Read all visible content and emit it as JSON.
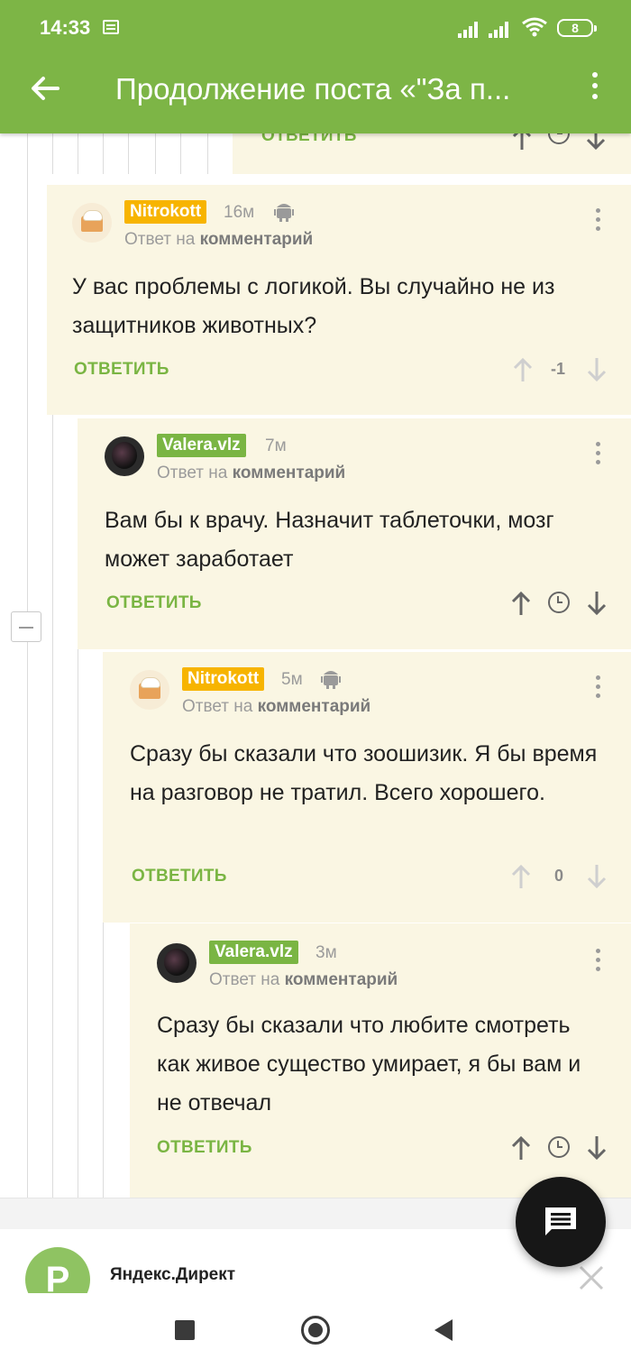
{
  "status_bar": {
    "time": "14:33",
    "battery": "8"
  },
  "header": {
    "title": "Продолжение поста «\"За п..."
  },
  "partial_reply_label": "ОТВЕТИТЬ",
  "comments": [
    {
      "author": "Nitrokott",
      "age": "16м",
      "reply_prefix": "Ответ на",
      "reply_target": "комментарий",
      "text": "У вас проблемы с логикой. Вы случайно не из защитников животных?",
      "reply_label": "ОТВЕТИТЬ",
      "score": "-1"
    },
    {
      "author": "Valera.vlz",
      "age": "7м",
      "reply_prefix": "Ответ на",
      "reply_target": "комментарий",
      "text": "Вам бы к врачу. Назначит таблеточки, мозг может заработает",
      "reply_label": "ОТВЕТИТЬ"
    },
    {
      "author": "Nitrokott",
      "age": "5м",
      "reply_prefix": "Ответ на",
      "reply_target": "комментарий",
      "text": "Сразу бы сказали что зоошизик. Я бы время на разговор не тратил. Всего хорошего.",
      "reply_label": "ОТВЕТИТЬ",
      "score": "0"
    },
    {
      "author": "Valera.vlz",
      "age": "3м",
      "reply_prefix": "Ответ на",
      "reply_target": "комментарий",
      "text": "Сразу бы сказали что любите смотреть как живое существо умирает, я бы вам и не отвечал",
      "reply_label": "ОТВЕТИТЬ"
    }
  ],
  "ad": {
    "logo_letter": "Р",
    "title": "Яндекс.Директ"
  },
  "colors": {
    "appbar": "#7db546",
    "comment_bg": "#faf6e3",
    "nick_yellow": "#f7b400",
    "nick_green": "#7ab543"
  }
}
